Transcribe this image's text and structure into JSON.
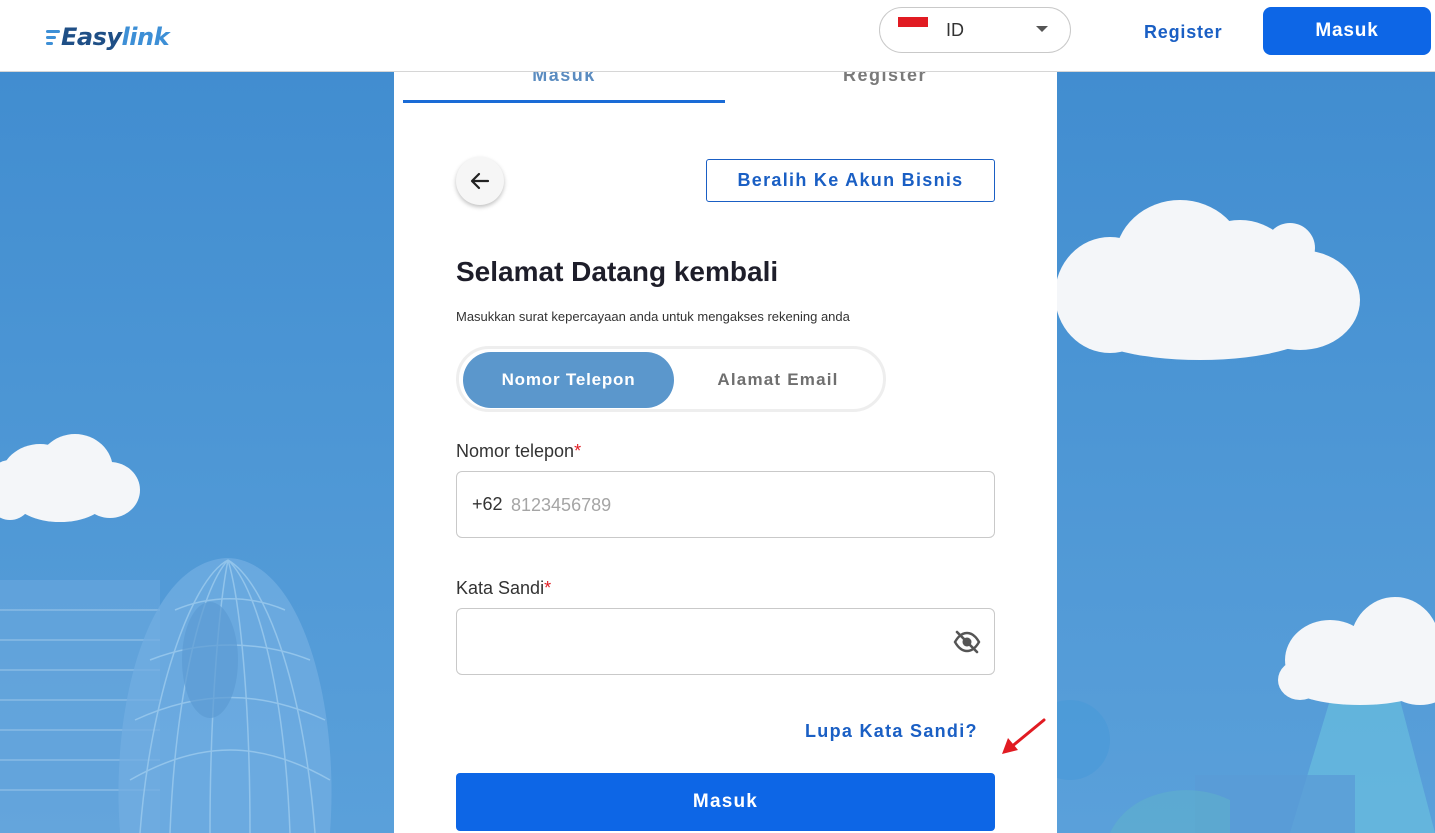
{
  "header": {
    "logo_text_main": "Easy",
    "logo_text_accent": "link",
    "language": {
      "code": "ID",
      "flag": "indonesia-flag-icon"
    },
    "register_label": "Register",
    "login_label": "Masuk"
  },
  "card": {
    "tabs": [
      {
        "label": "Masuk",
        "active": true
      },
      {
        "label": "Register",
        "active": false
      }
    ],
    "back_icon": "arrow-left-icon",
    "business_button_label": "Beralih Ke Akun Bisnis",
    "title": "Selamat Datang kembali",
    "subtitle": "Masukkan surat kepercayaan anda untuk mengakses rekening anda",
    "method_toggle": {
      "options": [
        "Nomor Telepon",
        "Alamat Email"
      ],
      "selected": "Nomor Telepon"
    },
    "phone_field": {
      "label": "Nomor telepon",
      "required_mark": "*",
      "prefix": "+62",
      "value": "",
      "placeholder": "8123456789"
    },
    "password_field": {
      "label": "Kata Sandi",
      "required_mark": "*",
      "value": "",
      "toggle_icon": "eye-off-icon"
    },
    "forgot_password_label": "Lupa Kata Sandi?",
    "submit_label": "Masuk"
  },
  "colors": {
    "primary": "#0d66e6",
    "link": "#1a5fc4",
    "toggle_active": "#5b97cc",
    "required": "#e11b22",
    "annotation_arrow": "#e11b22"
  }
}
